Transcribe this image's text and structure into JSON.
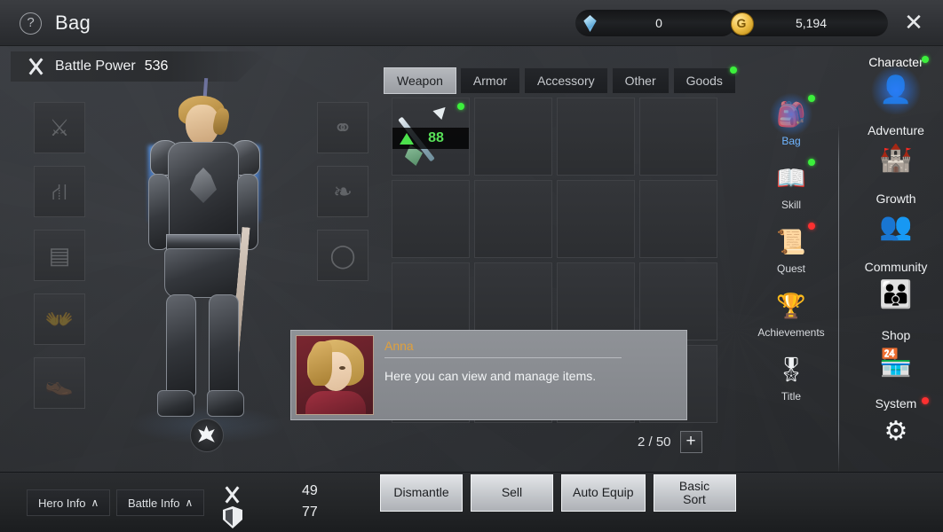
{
  "header": {
    "help_icon": "question-mark-icon",
    "title": "Bag",
    "gem_value": "0",
    "gold_value": "5,194",
    "close_label": "✕"
  },
  "battle_power": {
    "label": "Battle Power",
    "value": "536",
    "icon": "crossed-swords-icon"
  },
  "equipment_slots": [
    {
      "name": "weapon-slot",
      "ghost": "⚔"
    },
    {
      "name": "helmet-slot",
      "ghost": "⛑"
    },
    {
      "name": "chest-slot",
      "ghost": "☷"
    },
    {
      "name": "gloves-slot",
      "ghost": "✋"
    },
    {
      "name": "boots-slot",
      "ghost": "ὅE"
    }
  ],
  "accessory_slots": [
    {
      "name": "necklace-slot",
      "ghost": "◡"
    },
    {
      "name": "earrings-slot",
      "ghost": "❧"
    },
    {
      "name": "ring-slot",
      "ghost": "◯"
    }
  ],
  "tabs": [
    {
      "label": "Weapon",
      "active": true,
      "badge": ""
    },
    {
      "label": "Armor",
      "active": false,
      "badge": ""
    },
    {
      "label": "Accessory",
      "active": false,
      "badge": ""
    },
    {
      "label": "Other",
      "active": false,
      "badge": ""
    },
    {
      "label": "Goods",
      "active": false,
      "badge": "green"
    }
  ],
  "inventory": {
    "item": {
      "level": "88",
      "upgrade_indicator": "green-up-arrow",
      "badge": "green",
      "art": "sword-item-icon"
    },
    "capacity_text": "2 / 50",
    "add_slot_label": "+"
  },
  "dialog": {
    "speaker": "Anna",
    "text": "Here you can view and manage items.",
    "portrait": "anna-portrait"
  },
  "sidebar": [
    {
      "label": "Bag",
      "icon": "backpack-icon",
      "glyph": "🎒",
      "active": true,
      "badge": "green"
    },
    {
      "label": "Skill",
      "icon": "open-book-icon",
      "glyph": "📖",
      "active": false,
      "badge": "green"
    },
    {
      "label": "Quest",
      "icon": "quill-scroll-icon",
      "glyph": "📜",
      "active": false,
      "badge": "red"
    },
    {
      "label": "Achievements",
      "icon": "trophy-wreath-icon",
      "glyph": "🏆",
      "active": false,
      "badge": ""
    },
    {
      "label": "Title",
      "icon": "medal-icon",
      "glyph": "🎖",
      "active": false,
      "badge": ""
    }
  ],
  "rightnav": [
    {
      "label": "Character",
      "icon": "character-profile-icon",
      "glyph": "👤",
      "active": true,
      "badge": "green"
    },
    {
      "label": "Adventure",
      "icon": "dungeon-gate-icon",
      "glyph": "🏰",
      "active": false,
      "badge": ""
    },
    {
      "label": "Growth",
      "icon": "level-up-icon",
      "glyph": "👥",
      "active": false,
      "badge": ""
    },
    {
      "label": "Community",
      "icon": "people-group-icon",
      "glyph": "👪",
      "active": false,
      "badge": ""
    },
    {
      "label": "Shop",
      "icon": "shop-stall-icon",
      "glyph": "🏪",
      "active": false,
      "badge": ""
    },
    {
      "label": "System",
      "icon": "network-nodes-icon",
      "glyph": "⚙",
      "active": false,
      "badge": "red"
    }
  ],
  "bottom": {
    "hero_info_label": "Hero Info",
    "battle_info_label": "Battle Info",
    "chevron": "∧",
    "attack_value": "49",
    "defense_value": "77",
    "actions": [
      {
        "label": "Dismantle"
      },
      {
        "label": "Sell"
      },
      {
        "label": "Auto Equip"
      },
      {
        "label": "Basic\nSort"
      }
    ]
  }
}
